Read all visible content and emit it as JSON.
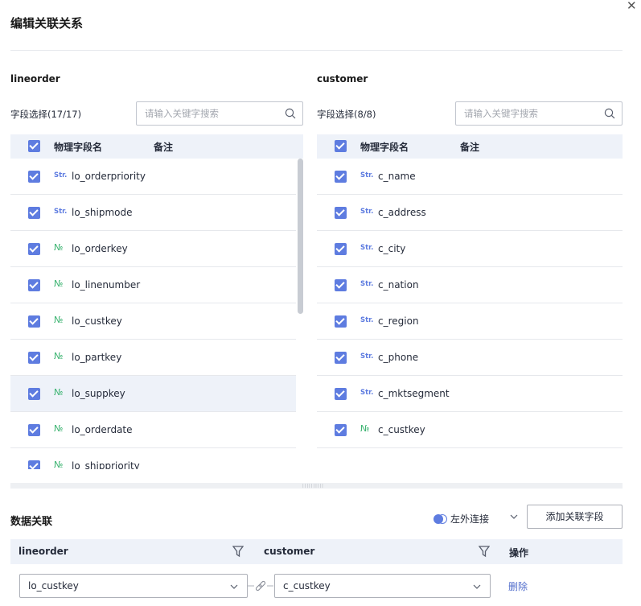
{
  "dialog": {
    "title": "编辑关联关系"
  },
  "left": {
    "title": "lineorder",
    "field_select": "字段选择(17/17)",
    "search_placeholder": "请输入关键字搜索",
    "col_name": "物理字段名",
    "col_note": "备注",
    "rows": [
      {
        "type": "Str.",
        "name": "lo_orderpriority"
      },
      {
        "type": "Str.",
        "name": "lo_shipmode"
      },
      {
        "type": "№",
        "name": "lo_orderkey"
      },
      {
        "type": "№",
        "name": "lo_linenumber"
      },
      {
        "type": "№",
        "name": "lo_custkey"
      },
      {
        "type": "№",
        "name": "lo_partkey"
      },
      {
        "type": "№",
        "name": "lo_suppkey"
      },
      {
        "type": "№",
        "name": "lo_orderdate"
      },
      {
        "type": "№",
        "name": "lo_shippriority"
      }
    ]
  },
  "right": {
    "title": "customer",
    "field_select": "字段选择(8/8)",
    "search_placeholder": "请输入关键字搜索",
    "col_name": "物理字段名",
    "col_note": "备注",
    "rows": [
      {
        "type": "Str.",
        "name": "c_name"
      },
      {
        "type": "Str.",
        "name": "c_address"
      },
      {
        "type": "Str.",
        "name": "c_city"
      },
      {
        "type": "Str.",
        "name": "c_nation"
      },
      {
        "type": "Str.",
        "name": "c_region"
      },
      {
        "type": "Str.",
        "name": "c_phone"
      },
      {
        "type": "Str.",
        "name": "c_mktsegment"
      },
      {
        "type": "№",
        "name": "c_custkey"
      }
    ]
  },
  "relation": {
    "title": "数据关联",
    "join_type": "左外连接",
    "add_button": "添加关联字段",
    "col_left": "lineorder",
    "col_right": "customer",
    "col_action": "操作",
    "left_value": "lo_custkey",
    "right_value": "c_custkey",
    "delete_label": "删除"
  },
  "colors": {
    "accent": "#5e7ce0",
    "number_type": "#3cb371",
    "header_bg": "#eef2f9"
  }
}
